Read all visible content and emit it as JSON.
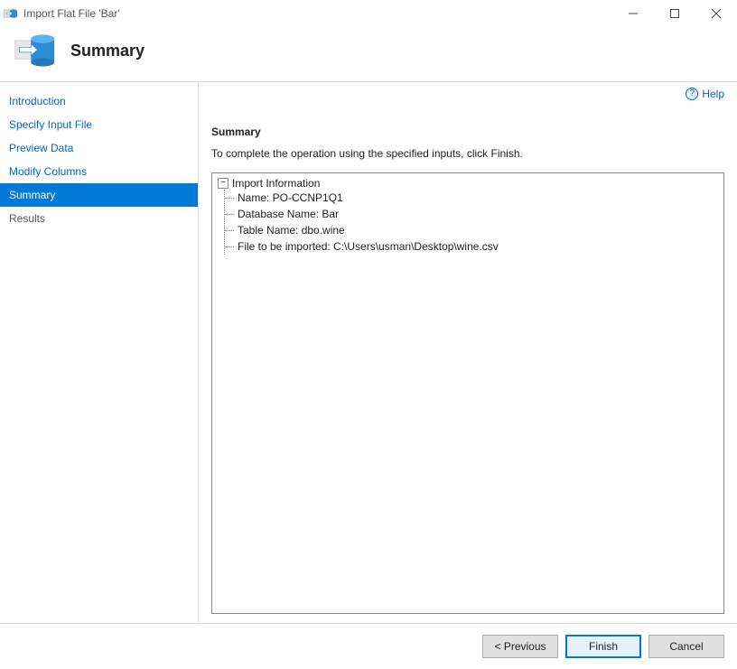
{
  "window": {
    "title": "Import Flat File 'Bar'"
  },
  "header": {
    "title": "Summary"
  },
  "sidebar": {
    "items": [
      {
        "label": "Introduction"
      },
      {
        "label": "Specify Input File"
      },
      {
        "label": "Preview Data"
      },
      {
        "label": "Modify Columns"
      },
      {
        "label": "Summary"
      },
      {
        "label": "Results"
      }
    ]
  },
  "help": {
    "label": "Help"
  },
  "main": {
    "section_title": "Summary",
    "section_desc": "To complete the operation using the specified inputs, click Finish.",
    "tree_root": "Import Information",
    "tree_items": [
      "Name: PO-CCNP1Q1",
      "Database Name: Bar",
      "Table Name: dbo.wine",
      "File to be imported: C:\\Users\\usman\\Desktop\\wine.csv"
    ]
  },
  "footer": {
    "previous": "< Previous",
    "finish": "Finish",
    "cancel": "Cancel"
  }
}
